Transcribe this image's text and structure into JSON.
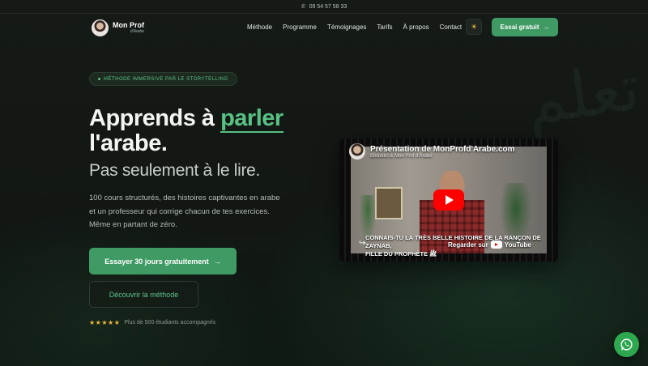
{
  "topbar": {
    "phone": "09 54 57 58 33",
    "phone_icon": "phone-icon"
  },
  "brand": {
    "name": "Mon Prof",
    "sub": "d'Arabe"
  },
  "nav": {
    "items": [
      "Méthode",
      "Programme",
      "Témoignages",
      "Tarifs",
      "À propos",
      "Contact"
    ],
    "theme_icon": "sun-icon",
    "cta": "Essai gratuit",
    "cta_icon": "→"
  },
  "hero": {
    "badge": "MÉTHODE IMMERSIVE PAR LE STORYTELLING",
    "title_part1": "Apprends à ",
    "title_accent": "parler",
    "title_part2": "l'arabe.",
    "subtitle": "Pas seulement à le lire.",
    "desc_line1": "100 cours structurés, des histoires captivantes en arabe",
    "desc_line2": "et un professeur qui corrige chacun de tes exercices.",
    "desc_line3": "Même en partant de zéro.",
    "primary_cta": "Essayer 30 jours gratuitement",
    "primary_cta_icon": "→",
    "secondary_cta": "Découvrir la méthode",
    "stars": "★★★★★",
    "rating_text": "Plus de 500 étudiants accompagnés",
    "accent_color": "#58c184"
  },
  "video": {
    "title": "Présentation de MonProfd'Arabe.com",
    "channel": "Bibloldin & Mon Prof d'Arabe",
    "caption_line1": "CONNAIS-TU LA TRÈS BELLE HISTOIRE DE LA RANÇON DE ZAYNAB,",
    "caption_line2": "FILLE DU PROPHÈTE ﷺ",
    "watch_label": "Regarder sur",
    "platform": "YouTube"
  },
  "whatsapp": {
    "icon": "whatsapp-icon"
  }
}
